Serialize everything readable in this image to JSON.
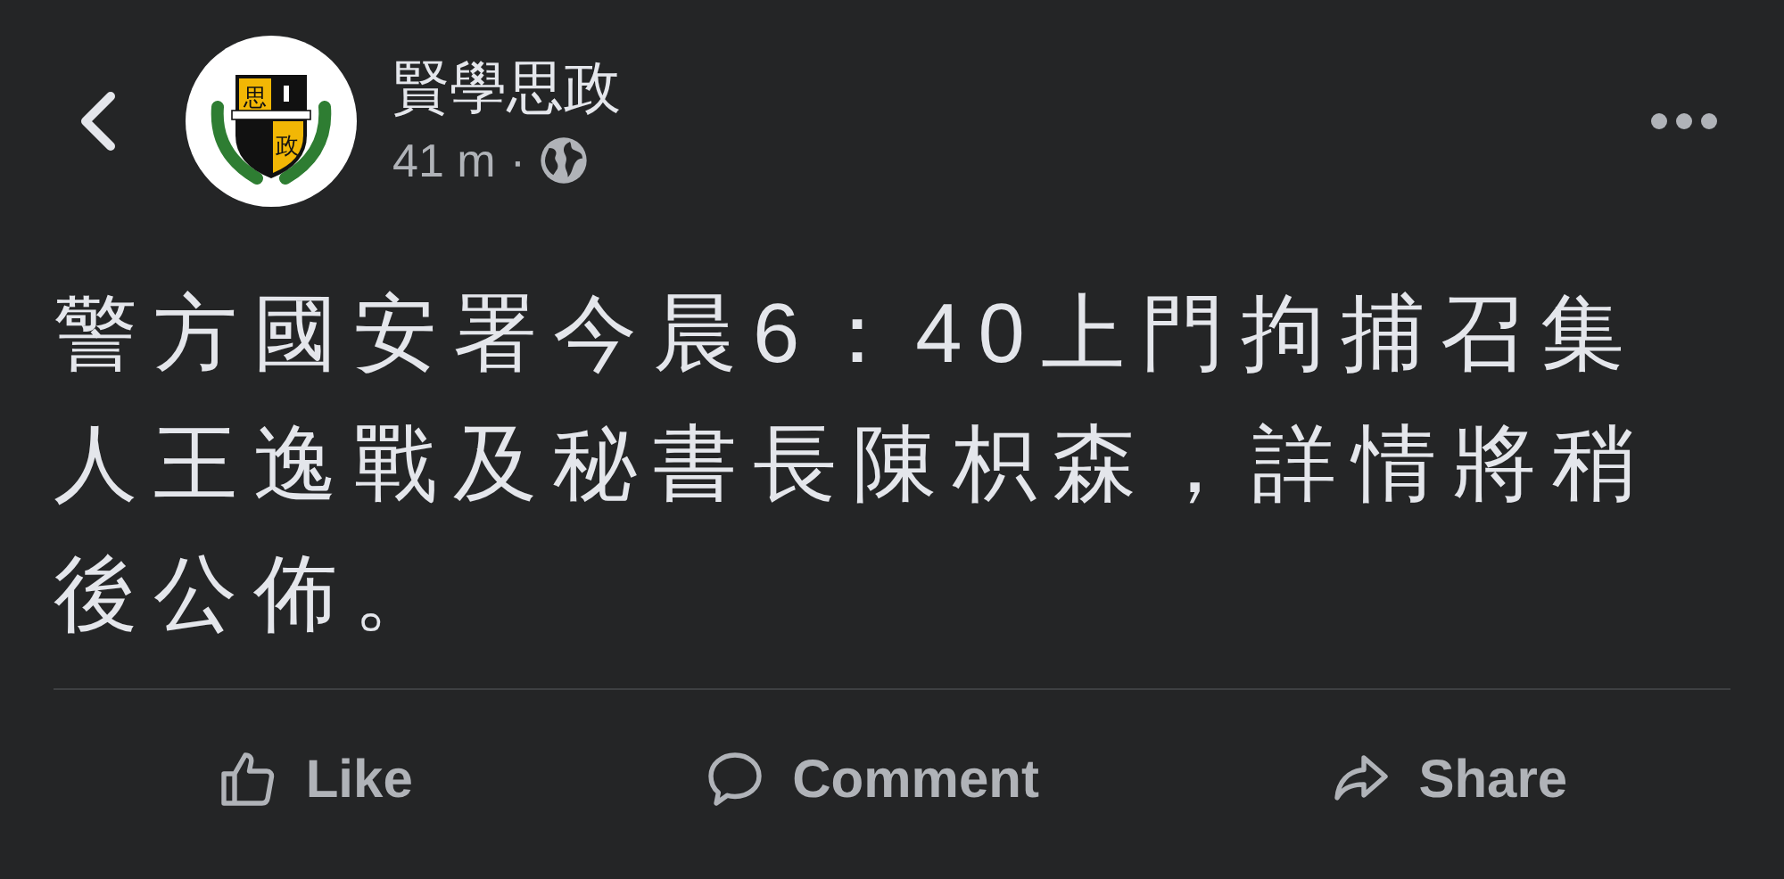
{
  "post": {
    "author": "賢學思政",
    "time": "41 m",
    "separator": "·",
    "logo_characters": [
      "思",
      "政"
    ],
    "text": "警方國安署今晨6：40上門拘捕召集人王逸戰及秘書長陳枳森，詳情將稍後公佈。"
  },
  "actions": [
    {
      "kind": "like",
      "label": "Like"
    },
    {
      "kind": "comment",
      "label": "Comment"
    },
    {
      "kind": "share",
      "label": "Share"
    }
  ]
}
